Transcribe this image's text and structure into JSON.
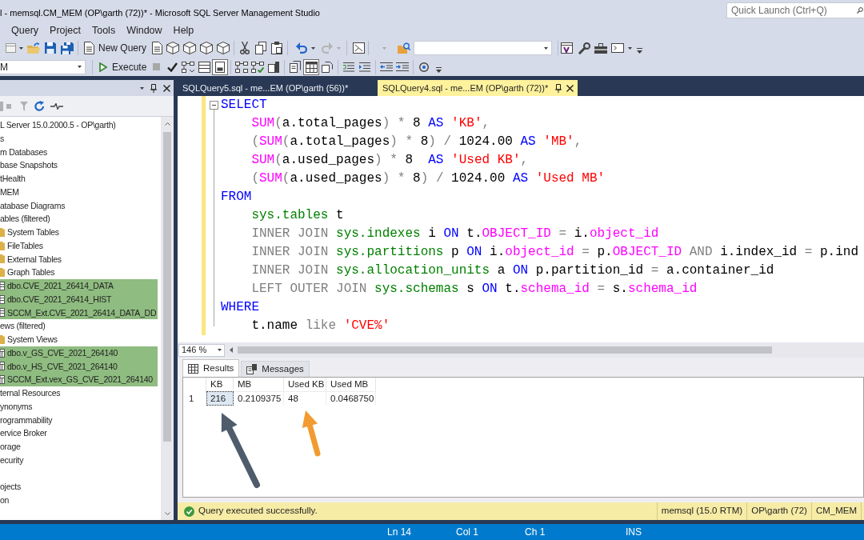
{
  "window": {
    "title": "l - memsql.CM_MEM (OP\\garth (72))* - Microsoft SQL Server Management Studio",
    "quick_launch": {
      "placeholder": "Quick Launch (Ctrl+Q)"
    }
  },
  "menu": [
    "Query",
    "Project",
    "Tools",
    "Window",
    "Help"
  ],
  "standard_toolbar": {
    "new_query": "New Query"
  },
  "query_toolbar": {
    "database": "M",
    "execute": "Execute",
    "buttons": [
      {
        "pressed": false
      },
      {
        "pressed": false
      },
      {
        "pressed": false
      },
      {
        "pressed": false
      },
      {
        "pressed": true
      },
      {
        "pressed": false
      },
      {
        "pressed": false
      },
      {
        "pressed": false
      },
      {
        "pressed": false
      },
      {
        "pressed": true
      },
      {
        "pressed": false
      },
      {
        "pressed": false
      },
      {
        "pressed": false
      },
      {
        "pressed": false
      },
      {
        "pressed": false
      },
      {
        "pressed": false
      }
    ]
  },
  "object_explorer": {
    "tree": [
      {
        "text": "L Server 15.0.2000.5 - OP\\garth)",
        "highlighted": false
      },
      {
        "text": "s",
        "highlighted": false
      },
      {
        "text": "m Databases",
        "highlighted": false
      },
      {
        "text": "base Snapshots",
        "highlighted": false
      },
      {
        "text": "tHealth",
        "highlighted": false
      },
      {
        "text": "MEM",
        "highlighted": false
      },
      {
        "text": "atabase Diagrams",
        "highlighted": false
      },
      {
        "text": "ables (filtered)",
        "highlighted": false
      },
      {
        "text": "System Tables",
        "kind": "folder",
        "highlighted": false
      },
      {
        "text": "FileTables",
        "kind": "folder",
        "highlighted": false
      },
      {
        "text": "External Tables",
        "kind": "folder",
        "highlighted": false
      },
      {
        "text": "Graph Tables",
        "kind": "folder",
        "highlighted": false
      },
      {
        "text": "dbo.CVE_2021_26414_DATA",
        "kind": "table",
        "highlighted": true
      },
      {
        "text": "dbo.CVE_2021_26414_HIST",
        "kind": "table",
        "highlighted": true
      },
      {
        "text": "SCCM_Ext.CVE_2021_26414_DATA_DD",
        "kind": "table",
        "highlighted": true
      },
      {
        "text": "ews (filtered)",
        "highlighted": false
      },
      {
        "text": "System Views",
        "kind": "folder",
        "highlighted": false
      },
      {
        "text": "dbo.v_GS_CVE_2021_264140",
        "kind": "view",
        "highlighted": true
      },
      {
        "text": "dbo.v_HS_CVE_2021_264140",
        "kind": "view",
        "highlighted": true
      },
      {
        "text": "SCCM_Ext.vex_GS_CVE_2021_264140",
        "kind": "view",
        "highlighted": true
      },
      {
        "text": "ternal Resources",
        "highlighted": false
      },
      {
        "text": "ynonyms",
        "highlighted": false
      },
      {
        "text": "rogrammability",
        "highlighted": false
      },
      {
        "text": "ervice Broker",
        "highlighted": false
      },
      {
        "text": "orage",
        "highlighted": false
      },
      {
        "text": "ecurity",
        "highlighted": false
      }
    ],
    "tree_lower": [
      {
        "text": "ojects",
        "highlighted": false
      },
      {
        "text": "on",
        "highlighted": false
      }
    ]
  },
  "editor_tabs": [
    {
      "label": "SQLQuery5.sql - me...EM (OP\\garth (56))*",
      "selected": false
    },
    {
      "label": "SQLQuery4.sql - me...EM (OP\\garth (72))*",
      "selected": true
    }
  ],
  "editor": {
    "lines": [
      {
        "modified": true,
        "tokens": [
          {
            "text": "SELECT",
            "kind": "keyword"
          }
        ]
      },
      {
        "modified": true,
        "tokens": [
          {
            "text": "    SUM",
            "kind": "function"
          },
          {
            "text": "(",
            "kind": "operator"
          },
          {
            "text": "a.total_pages",
            "kind": "plain"
          },
          {
            "text": ") * ",
            "kind": "operator"
          },
          {
            "text": "8 ",
            "kind": "plain"
          },
          {
            "text": "AS ",
            "kind": "keyword"
          },
          {
            "text": "'KB'",
            "kind": "string"
          },
          {
            "text": ",",
            "kind": "operator"
          }
        ]
      },
      {
        "modified": true,
        "tokens": [
          {
            "text": "    (",
            "kind": "operator"
          },
          {
            "text": "SUM",
            "kind": "function"
          },
          {
            "text": "(",
            "kind": "operator"
          },
          {
            "text": "a.total_pages",
            "kind": "plain"
          },
          {
            "text": ") * ",
            "kind": "operator"
          },
          {
            "text": "8",
            "kind": "plain"
          },
          {
            "text": ") / ",
            "kind": "operator"
          },
          {
            "text": "1024.00 ",
            "kind": "plain"
          },
          {
            "text": "AS ",
            "kind": "keyword"
          },
          {
            "text": "'MB'",
            "kind": "string"
          },
          {
            "text": ",",
            "kind": "operator"
          }
        ]
      },
      {
        "modified": true,
        "tokens": [
          {
            "text": "    SUM",
            "kind": "function"
          },
          {
            "text": "(",
            "kind": "operator"
          },
          {
            "text": "a.used_pages",
            "kind": "plain"
          },
          {
            "text": ") * ",
            "kind": "operator"
          },
          {
            "text": "8  ",
            "kind": "plain"
          },
          {
            "text": "AS ",
            "kind": "keyword"
          },
          {
            "text": "'Used KB'",
            "kind": "string"
          },
          {
            "text": ",",
            "kind": "operator"
          }
        ]
      },
      {
        "modified": true,
        "tokens": [
          {
            "text": "    (",
            "kind": "operator"
          },
          {
            "text": "SUM",
            "kind": "function"
          },
          {
            "text": "(",
            "kind": "operator"
          },
          {
            "text": "a.used_pages",
            "kind": "plain"
          },
          {
            "text": ") * ",
            "kind": "operator"
          },
          {
            "text": "8",
            "kind": "plain"
          },
          {
            "text": ") / ",
            "kind": "operator"
          },
          {
            "text": "1024.00 ",
            "kind": "plain"
          },
          {
            "text": "AS ",
            "kind": "keyword"
          },
          {
            "text": "'Used MB'",
            "kind": "string"
          }
        ]
      },
      {
        "modified": true,
        "tokens": [
          {
            "text": "FROM",
            "kind": "keyword"
          }
        ]
      },
      {
        "modified": true,
        "tokens": [
          {
            "text": "    sys.tables",
            "kind": "system"
          },
          {
            "text": " t",
            "kind": "plain"
          }
        ]
      },
      {
        "modified": true,
        "tokens": [
          {
            "text": "    INNER JOIN ",
            "kind": "operator"
          },
          {
            "text": "sys.indexes",
            "kind": "system"
          },
          {
            "text": " i ",
            "kind": "plain"
          },
          {
            "text": "ON ",
            "kind": "keyword"
          },
          {
            "text": "t.",
            "kind": "plain"
          },
          {
            "text": "OBJECT_ID",
            "kind": "function"
          },
          {
            "text": " = ",
            "kind": "operator"
          },
          {
            "text": "i.",
            "kind": "plain"
          },
          {
            "text": "object_id",
            "kind": "function"
          }
        ]
      },
      {
        "modified": true,
        "tokens": [
          {
            "text": "    INNER JOIN ",
            "kind": "operator"
          },
          {
            "text": "sys.partitions",
            "kind": "system"
          },
          {
            "text": " p ",
            "kind": "plain"
          },
          {
            "text": "ON ",
            "kind": "keyword"
          },
          {
            "text": "i.",
            "kind": "plain"
          },
          {
            "text": "object_id",
            "kind": "function"
          },
          {
            "text": " = ",
            "kind": "operator"
          },
          {
            "text": "p.",
            "kind": "plain"
          },
          {
            "text": "OBJECT_ID",
            "kind": "function"
          },
          {
            "text": " AND ",
            "kind": "operator"
          },
          {
            "text": "i.index_id",
            "kind": "plain"
          },
          {
            "text": " = ",
            "kind": "operator"
          },
          {
            "text": "p.ind",
            "kind": "plain"
          }
        ]
      },
      {
        "modified": true,
        "tokens": [
          {
            "text": "    INNER JOIN ",
            "kind": "operator"
          },
          {
            "text": "sys.allocation_units",
            "kind": "system"
          },
          {
            "text": " a ",
            "kind": "plain"
          },
          {
            "text": "ON ",
            "kind": "keyword"
          },
          {
            "text": "p.partition_id",
            "kind": "plain"
          },
          {
            "text": " = ",
            "kind": "operator"
          },
          {
            "text": "a.container_id",
            "kind": "plain"
          }
        ]
      },
      {
        "modified": true,
        "tokens": [
          {
            "text": "    LEFT OUTER JOIN ",
            "kind": "operator"
          },
          {
            "text": "sys.schemas",
            "kind": "system"
          },
          {
            "text": " s ",
            "kind": "plain"
          },
          {
            "text": "ON ",
            "kind": "keyword"
          },
          {
            "text": "t.",
            "kind": "plain"
          },
          {
            "text": "schema_id",
            "kind": "function"
          },
          {
            "text": " = ",
            "kind": "operator"
          },
          {
            "text": "s.",
            "kind": "plain"
          },
          {
            "text": "schema_id",
            "kind": "function"
          }
        ]
      },
      {
        "modified": true,
        "tokens": [
          {
            "text": "WHERE",
            "kind": "keyword"
          }
        ]
      },
      {
        "modified": true,
        "tokens": [
          {
            "text": "    t.name ",
            "kind": "plain"
          },
          {
            "text": "like ",
            "kind": "operator"
          },
          {
            "text": "'CVE%'",
            "kind": "string"
          }
        ]
      }
    ]
  },
  "zoom": "146 %",
  "results": {
    "tabs": [
      {
        "label": "Results",
        "selected": true
      },
      {
        "label": "Messages",
        "selected": false
      }
    ],
    "columns": [
      "KB",
      "MB",
      "Used KB",
      "Used MB"
    ],
    "rows": [
      {
        "number": "1",
        "cells": [
          {
            "text": "216",
            "selected": true
          },
          {
            "text": "0.2109375",
            "selected": false
          },
          {
            "text": "48",
            "selected": false
          },
          {
            "text": "0.0468750",
            "selected": false
          }
        ]
      }
    ],
    "annotations": [
      {
        "kind": "arrow",
        "color": "#4e5c6b"
      },
      {
        "kind": "arrow",
        "color": "#f29b30"
      }
    ]
  },
  "query_status": {
    "kind": "success",
    "message": "Query executed successfully.",
    "segments": [
      "memsql (15.0 RTM)",
      "OP\\garth (72)",
      "CM_MEM"
    ]
  },
  "status_bar": [
    "Ln 14",
    "Col 1",
    "Ch 1",
    "INS"
  ]
}
